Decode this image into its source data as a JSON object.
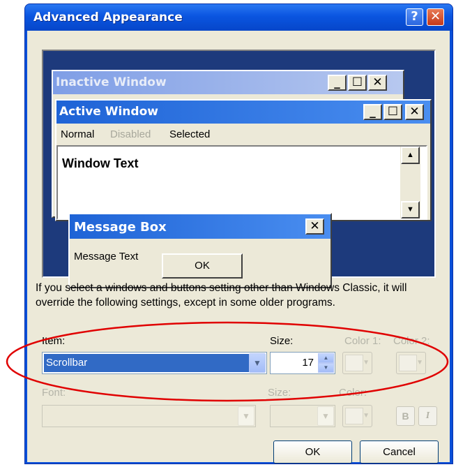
{
  "dialog": {
    "title": "Advanced Appearance",
    "help_glyph": "?",
    "close_glyph": "✕"
  },
  "preview": {
    "inactive_window": {
      "title": "Inactive Window",
      "minimize": "_",
      "maximize": "☐",
      "close": "✕"
    },
    "active_window": {
      "title": "Active Window",
      "minimize": "_",
      "maximize": "☐",
      "close": "✕",
      "menu": {
        "normal": "Normal",
        "disabled": "Disabled",
        "selected": "Selected"
      },
      "window_text": "Window Text",
      "scroll_up": "▲",
      "scroll_down": "▼"
    },
    "message_box": {
      "title": "Message Box",
      "close": "✕",
      "text": "Message Text",
      "ok": "OK"
    }
  },
  "info_text": "If you select a windows and buttons setting other than Windows Classic, it will override the following settings, except in some older programs.",
  "item_row": {
    "item_label": "Item:",
    "item_value": "Scrollbar",
    "size_label": "Size:",
    "size_value": "17",
    "color1_label": "Color 1:",
    "color2_label": "Color 2:"
  },
  "font_row": {
    "font_label": "Font:",
    "size_label": "Size:",
    "color_label": "Color:",
    "bold": "B",
    "italic": "I"
  },
  "buttons": {
    "ok": "OK",
    "cancel": "Cancel"
  },
  "colors": {
    "highlight_ellipse": "#e00000",
    "selection": "#316ac5",
    "preview_desktop": "#1d3a7c"
  }
}
